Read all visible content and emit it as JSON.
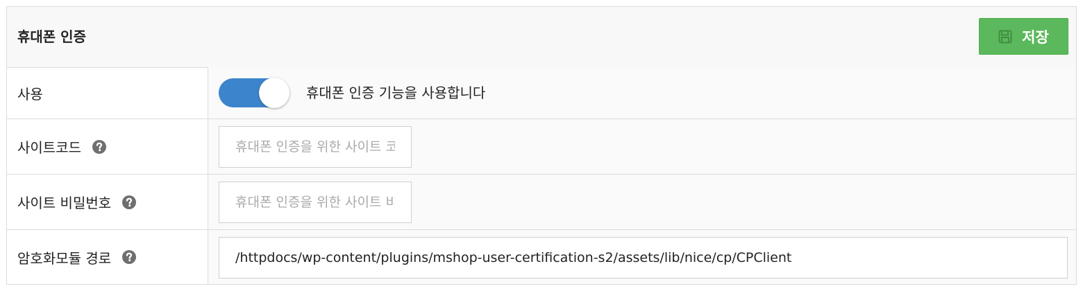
{
  "panel": {
    "title": "휴대폰 인증",
    "save_label": "저장"
  },
  "rows": [
    {
      "label": "사용",
      "toggle_on": true,
      "description": "휴대폰 인증 기능을 사용합니다"
    },
    {
      "label": "사이트코드",
      "placeholder": "휴대폰 인증을 위한 사이트 코",
      "value": ""
    },
    {
      "label": "사이트 비밀번호",
      "placeholder": "휴대폰 인증을 위한 사이트 비",
      "value": ""
    },
    {
      "label": "암호화모듈 경로",
      "placeholder": "",
      "value": "/httpdocs/wp-content/plugins/mshop-user-certification-s2/assets/lib/nice/cp/CPClient"
    }
  ],
  "icons": {
    "save": "floppy-disk-icon",
    "help": "question-circle-icon"
  },
  "colors": {
    "save_button": "#5cb85c",
    "toggle_on": "#3c84cc",
    "help_icon": "#6f6f6f"
  }
}
